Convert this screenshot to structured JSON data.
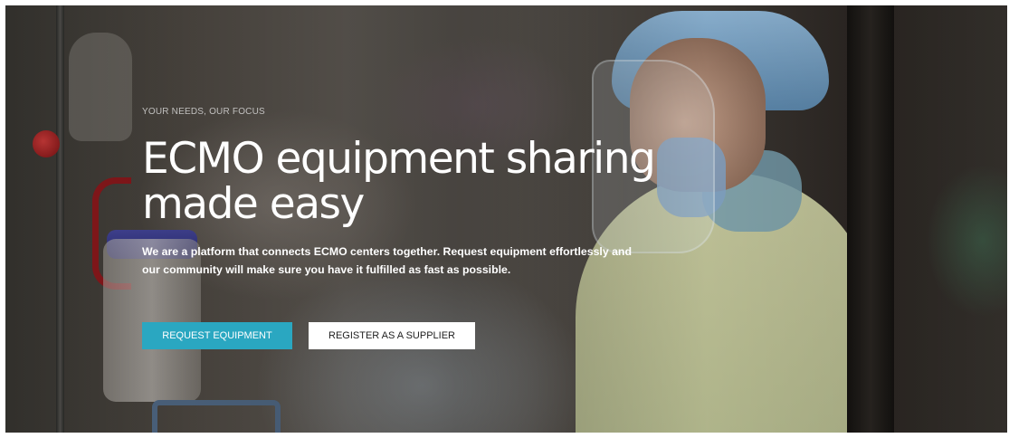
{
  "hero": {
    "eyebrow": "YOUR NEEDS, OUR FOCUS",
    "headline": "ECMO equipment sharing made easy",
    "description": "We are a platform that connects ECMO centers together. Request equipment effortlessly and our community will make sure you have it fulfilled as fast as possible.",
    "primary_button_label": "REQUEST EQUIPMENT",
    "secondary_button_label": "REGISTER AS A SUPPLIER"
  },
  "colors": {
    "accent": "#2aa7c1",
    "secondary_button_bg": "#ffffff",
    "text_light": "#ffffff"
  }
}
